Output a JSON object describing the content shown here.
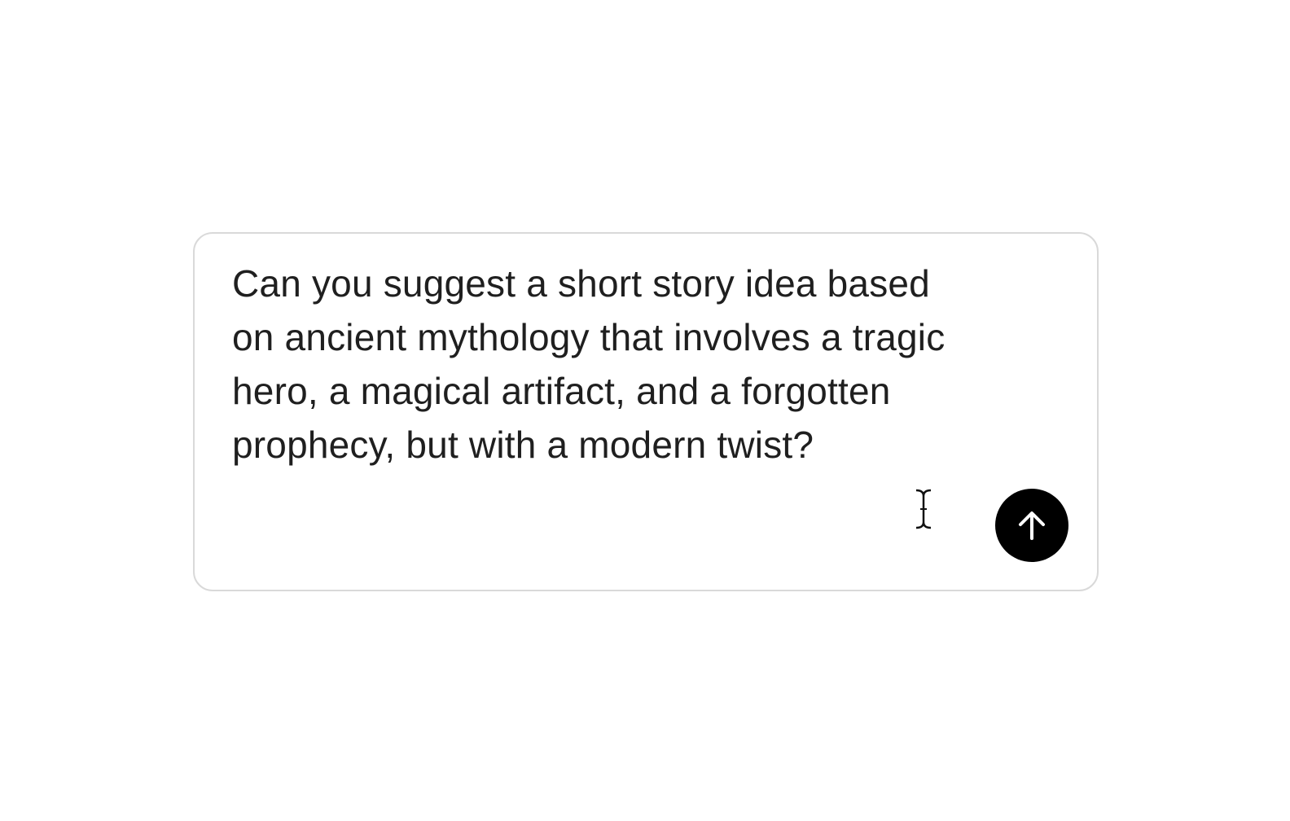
{
  "composer": {
    "prompt_text": "Can you suggest a short story idea based\non ancient mythology that involves a tragic\nhero, a magical artifact, and a forgotten\nprophecy, but with a modern twist?",
    "send_icon": "arrow-up-icon",
    "cursor_icon": "text-cursor-icon"
  },
  "colors": {
    "text": "#1f1f1f",
    "border": "#d9d9d9",
    "send_button": "#000000",
    "send_icon": "#ffffff"
  }
}
